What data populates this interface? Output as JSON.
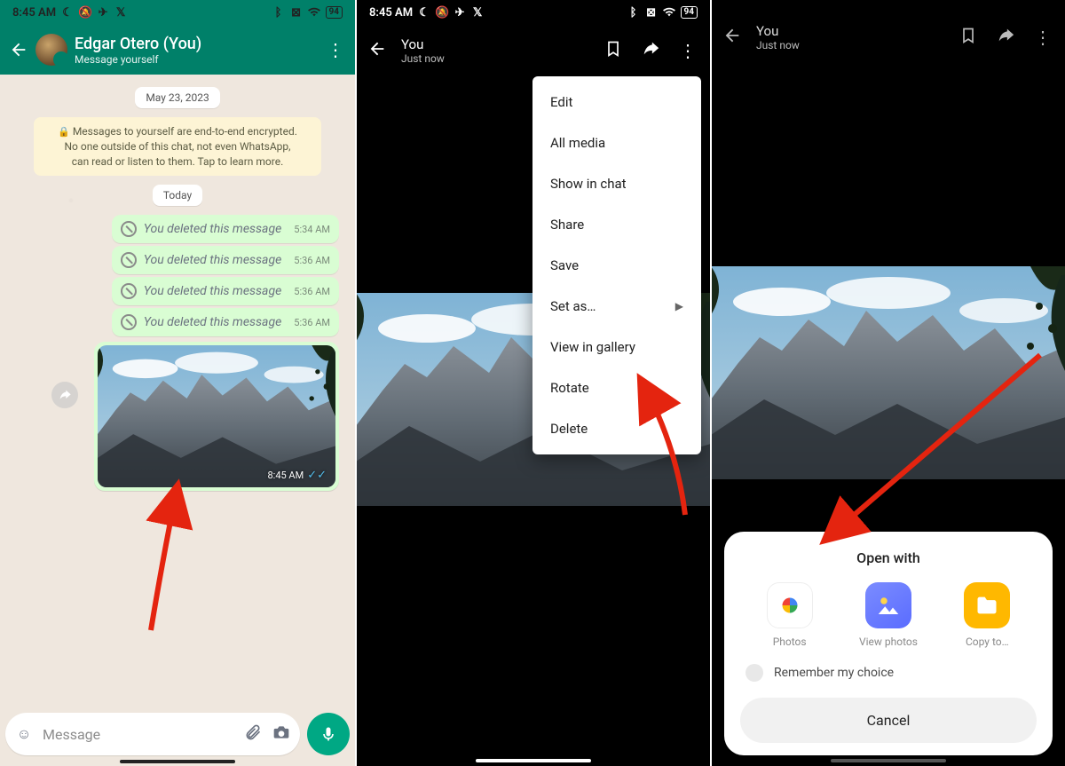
{
  "statusbar": {
    "time": "8:45 AM",
    "battery": "94"
  },
  "panel1": {
    "chat_title": "Edgar Otero (You)",
    "chat_subtitle": "Message yourself",
    "date_chip": "May 23, 2023",
    "encryption_notice": "Messages to yourself are end-to-end encrypted. No one outside of this chat, not even WhatsApp, can read or listen to them. Tap to learn more.",
    "today_chip": "Today",
    "deleted_label": "You deleted this message",
    "msgs": [
      {
        "time": "5:34 AM"
      },
      {
        "time": "5:36 AM"
      },
      {
        "time": "5:36 AM"
      },
      {
        "time": "5:36 AM"
      }
    ],
    "img_time": "8:45 AM",
    "input_placeholder": "Message"
  },
  "panel2": {
    "title": "You",
    "subtitle": "Just now",
    "menu": {
      "edit": "Edit",
      "all_media": "All media",
      "show_in_chat": "Show in chat",
      "share": "Share",
      "save": "Save",
      "set_as": "Set as…",
      "view_gallery": "View in gallery",
      "rotate": "Rotate",
      "delete": "Delete"
    }
  },
  "panel3": {
    "title": "You",
    "subtitle": "Just now",
    "sheet_title": "Open with",
    "apps": {
      "photos": "Photos",
      "view": "View photos",
      "copy": "Copy to…"
    },
    "remember": "Remember my choice",
    "cancel": "Cancel"
  }
}
